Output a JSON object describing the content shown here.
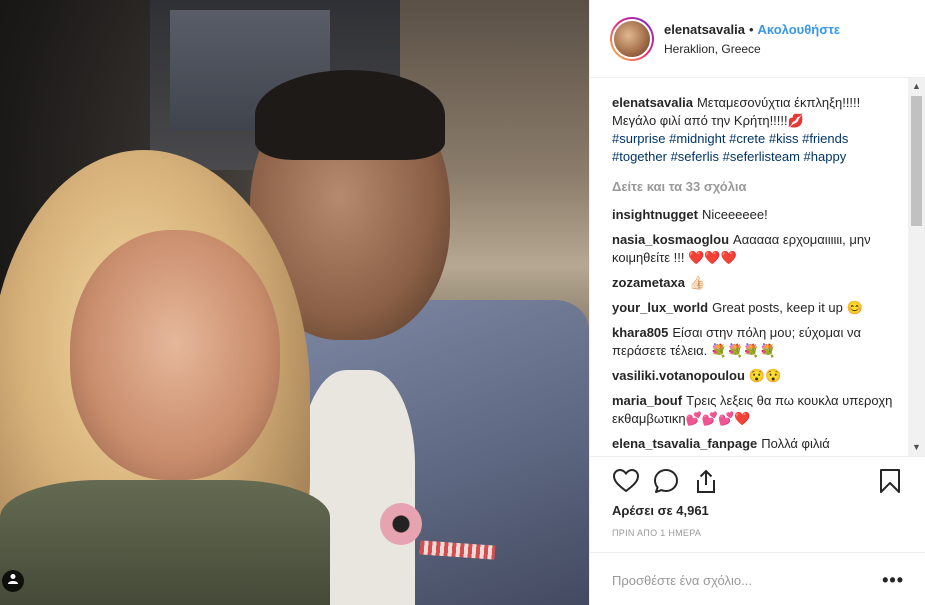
{
  "header": {
    "username": "elenatsavalia",
    "separator": "•",
    "follow_label": "Ακολουθήστε",
    "location": "Heraklion, Greece"
  },
  "caption": {
    "username": "elenatsavalia",
    "text": "Μεταμεσονύχτια έκπληξη!!!!! Μεγάλο φιλί από την Κρήτη!!!!!💋",
    "hashtags": [
      "#surprise",
      "#midnight",
      "#crete",
      "#kiss",
      "#friends",
      "#together",
      "#seferlis",
      "#seferlisteam",
      "#happy"
    ]
  },
  "view_more_label": "Δείτε και τα 33 σχόλια",
  "comments": [
    {
      "username": "insightnugget",
      "text": "Niceeeeee!"
    },
    {
      "username": "nasia_kosmaoglou",
      "text": "Αααααα ερχομαιιιιιι, μην κοιμηθείτε !!! ❤️❤️❤️"
    },
    {
      "username": "zozametaxa",
      "text": "👍🏻"
    },
    {
      "username": "your_lux_world",
      "text": "Great posts, keep it up 😊"
    },
    {
      "username": "khara805",
      "text": "Είσαι στην πόλη μου; εύχομαι να περάσετε τέλεια. 💐💐💐💐"
    },
    {
      "username": "vasiliki.votanopoulou",
      "text": "😯😯"
    },
    {
      "username": "maria_bouf",
      "text": "Τρεις λεξεις θα πω κουκλα υπεροχη εκθαμβωτικη💕💕💕❤️"
    },
    {
      "username": "elena_tsavalia_fanpage",
      "text": "Πολλά φιλιά αγαπημένη μου @elenatsavalia"
    }
  ],
  "likes_label": "Αρέσει σε 4,961",
  "timestamp": "ΠΡΙΝ ΑΠΟ 1 ΗΜΕΡΑ",
  "add_comment": {
    "placeholder": "Προσθέστε ένα σχόλιο...",
    "more_label": "•••"
  },
  "icons": {
    "like": "heart-icon",
    "comment": "comment-icon",
    "share": "share-icon",
    "save": "bookmark-icon",
    "user_tag": "user-tag-icon"
  },
  "colors": {
    "link": "#3897f0",
    "hashtag": "#003569",
    "muted": "#999999"
  }
}
